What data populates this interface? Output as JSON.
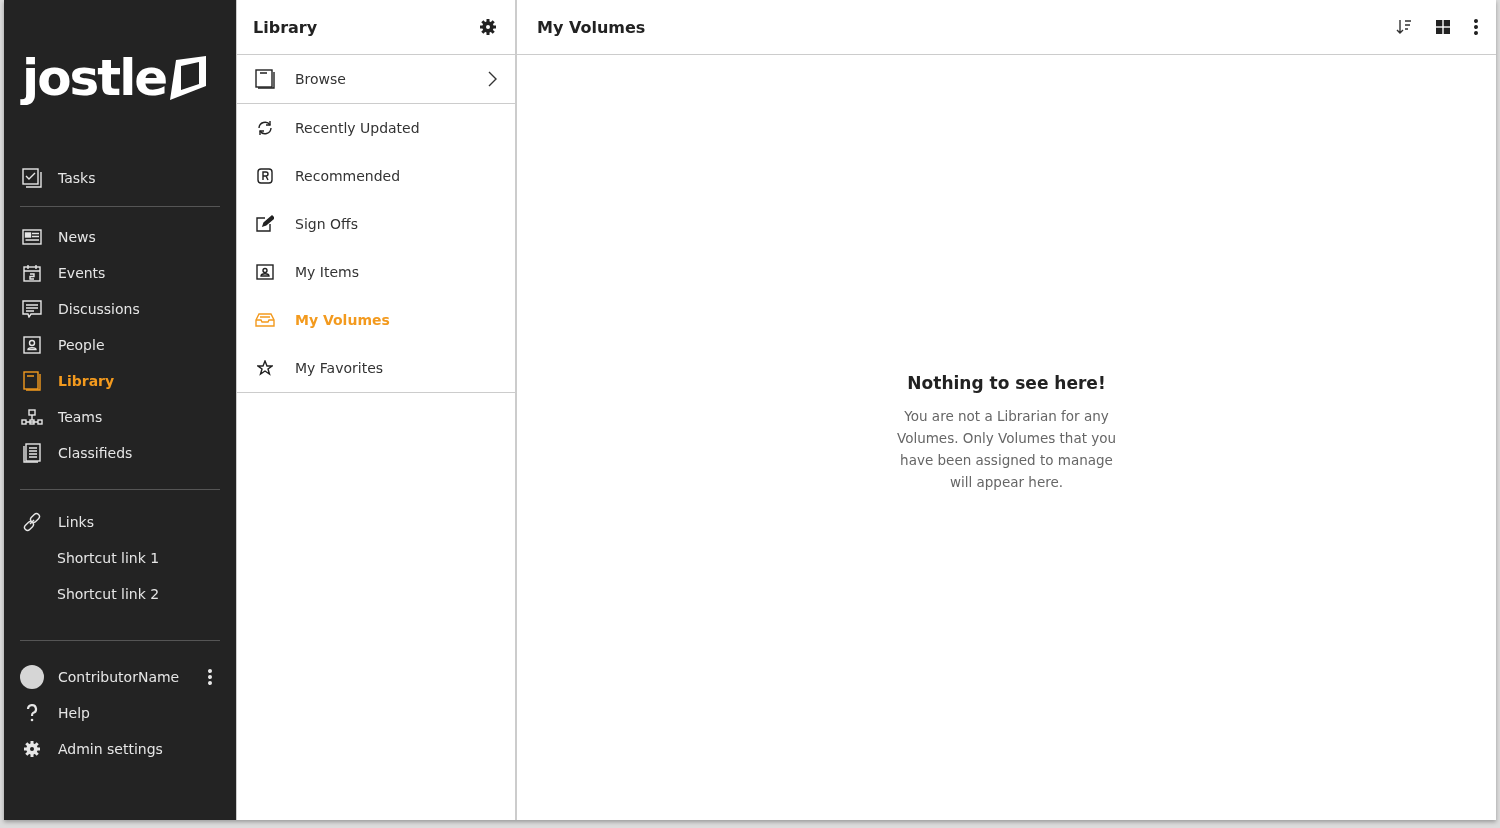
{
  "logo": {
    "text": "jostle"
  },
  "nav": {
    "top": [
      {
        "label": "Tasks",
        "selected": false
      }
    ],
    "sections": [
      {
        "label": "News",
        "selected": false
      },
      {
        "label": "Events",
        "selected": false
      },
      {
        "label": "Discussions",
        "selected": false
      },
      {
        "label": "People",
        "selected": false
      },
      {
        "label": "Library",
        "selected": true
      },
      {
        "label": "Teams",
        "selected": false
      },
      {
        "label": "Classifieds",
        "selected": false
      }
    ],
    "links": {
      "label": "Links",
      "items": [
        "Shortcut link 1",
        "Shortcut link 2"
      ]
    },
    "user": {
      "name": "ContributorName"
    },
    "bottom": [
      {
        "label": "Help"
      },
      {
        "label": "Admin settings"
      }
    ]
  },
  "library": {
    "title": "Library",
    "items": [
      {
        "label": "Browse",
        "selected": false
      },
      {
        "label": "Recently Updated",
        "selected": false
      },
      {
        "label": "Recommended",
        "selected": false
      },
      {
        "label": "Sign Offs",
        "selected": false
      },
      {
        "label": "My Items",
        "selected": false
      },
      {
        "label": "My Volumes",
        "selected": true
      },
      {
        "label": "My Favorites",
        "selected": false
      }
    ]
  },
  "main": {
    "title": "My Volumes",
    "empty_title": "Nothing to see here!",
    "empty_text": "You are not a Librarian for any Volumes. Only Volumes that you have been assigned to manage will appear here."
  }
}
